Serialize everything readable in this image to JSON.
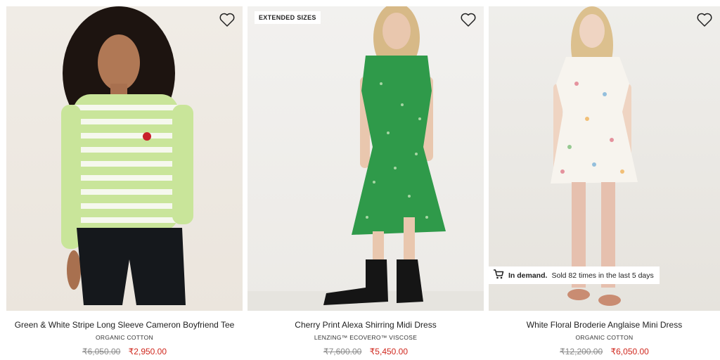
{
  "products": [
    {
      "title": "Green & White Stripe Long Sleeve Cameron Boyfriend Tee",
      "subtitle": "ORGANIC COTTON",
      "old_price": "₹6,050.00",
      "new_price": "₹2,950.00",
      "wishlist_icon": "heart-outline-icon"
    },
    {
      "badge": "EXTENDED SIZES",
      "title": "Cherry Print Alexa Shirring Midi Dress",
      "subtitle": "LENZING™ ECOVERO™ VISCOSE",
      "old_price": "₹7,600.00",
      "new_price": "₹5,450.00",
      "wishlist_icon": "heart-outline-icon"
    },
    {
      "title": "White Floral Broderie Anglaise Mini Dress",
      "subtitle": "ORGANIC COTTON",
      "old_price": "₹12,200.00",
      "new_price": "₹6,050.00",
      "wishlist_icon": "heart-outline-icon",
      "demand": {
        "strong": "In demand.",
        "text": "Sold 82 times in the last 5 days",
        "icon": "cart-icon"
      }
    }
  ],
  "colors": {
    "sale_price": "#d0281e",
    "old_price": "#8a8a8a"
  }
}
